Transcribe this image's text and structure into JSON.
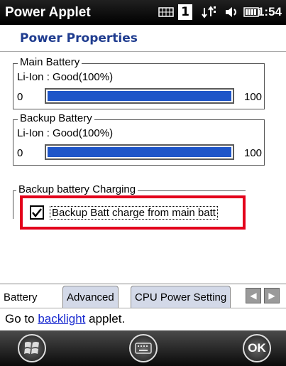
{
  "titlebar": {
    "app_title": "Power Applet",
    "time": "1:54",
    "icons": [
      "battery-grid-icon",
      "sim-1-icon",
      "network-sync-icon",
      "volume-icon",
      "battery-icon"
    ],
    "sim_label": "1"
  },
  "header": {
    "title": "Power Properties"
  },
  "main_battery": {
    "legend": "Main Battery",
    "status": "Li-Ion : Good(100%)",
    "min": "0",
    "max": "100",
    "level_percent": 100
  },
  "backup_battery": {
    "legend": "Backup Battery",
    "status": "Li-Ion : Good(100%)",
    "min": "0",
    "max": "100",
    "level_percent": 100
  },
  "charging": {
    "legend": "Backup battery Charging",
    "checkbox_label": "Backup Batt charge from main batt",
    "checked": true
  },
  "tabs": [
    {
      "label": "Battery",
      "active": true
    },
    {
      "label": "Advanced",
      "active": false
    },
    {
      "label": "CPU Power Setting",
      "active": false
    }
  ],
  "link_row": {
    "prefix": "Go to ",
    "link": "backlight",
    "suffix": " applet."
  },
  "softkeys": {
    "start": "windows-start-icon",
    "keyboard": "keyboard-icon",
    "ok": "OK"
  },
  "colors": {
    "progress_fill": "#1e55c8",
    "highlight_border": "#e3001b",
    "header_text": "#1f3c8f"
  }
}
